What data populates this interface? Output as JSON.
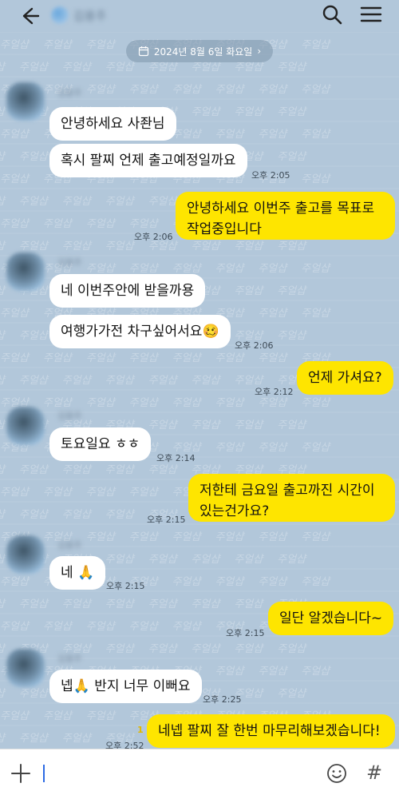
{
  "header": {
    "contact_name": "김용주",
    "back_icon": "back-arrow-icon",
    "search_icon": "search-icon",
    "menu_icon": "hamburger-menu-icon"
  },
  "date_divider": {
    "label": "2024년 8월 6일 화요일"
  },
  "watermark_text": "주얼샵",
  "messages": [
    {
      "sender": "them",
      "name": "김용주",
      "text": "안녕하세요 사좐님"
    },
    {
      "sender": "them",
      "text": "혹시 팔찌 언제 출고예정일까요",
      "time": "오후 2:05"
    },
    {
      "sender": "me",
      "line1": "안녕하세요 이번주 출고를 목표로",
      "line2": "작업중입니다",
      "time": "오후 2:06"
    },
    {
      "sender": "them",
      "name": "김용주",
      "text": "네 이번주안에 받을까용"
    },
    {
      "sender": "them",
      "text": "여행가가전 차구싶어서요",
      "emoji": "🥴",
      "time": "오후 2:06"
    },
    {
      "sender": "me",
      "text": "언제 가셔요?",
      "time": "오후 2:12"
    },
    {
      "sender": "them",
      "name": "김용주",
      "text": "토요일요 ㅎㅎ",
      "time": "오후 2:14"
    },
    {
      "sender": "me",
      "line1": "저한테 금요일 출고까진 시간이",
      "line2": "있는건가요?",
      "time": "오후 2:15"
    },
    {
      "sender": "them",
      "name": "김용주",
      "text": "네",
      "emoji": "🙏",
      "time": "오후 2:15"
    },
    {
      "sender": "me",
      "text": "일단 알겠습니다~",
      "time": "오후 2:15"
    },
    {
      "sender": "them",
      "name": "김용주",
      "text": "넵",
      "emoji": "🙏",
      "text2": " 반지 너무 이뻐요",
      "time": "오후 2:25"
    },
    {
      "sender": "me",
      "text": "네넵 팔찌 잘 한번 마무리해보겠습니다!",
      "time": "오후 2:52",
      "unread": "1"
    }
  ],
  "input_bar": {
    "placeholder": "",
    "add_icon": "plus-icon",
    "emoji_icon": "emoji-icon",
    "hash_label": "#"
  },
  "colors": {
    "background": "#b2c7da",
    "my_bubble": "#fee500",
    "their_bubble": "#ffffff"
  }
}
